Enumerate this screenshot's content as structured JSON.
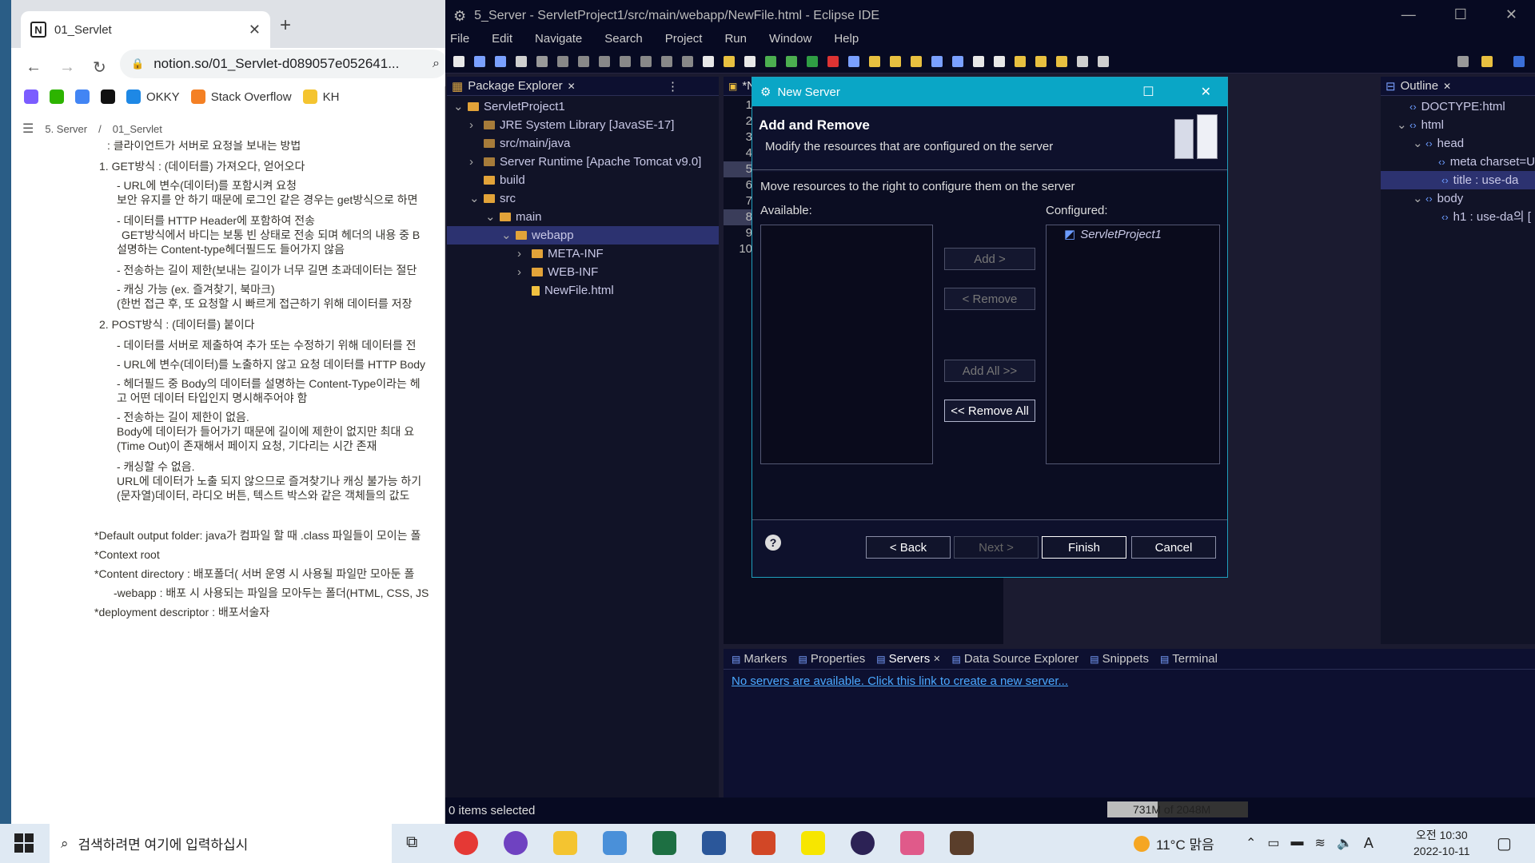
{
  "browser": {
    "tab_title": "01_Servlet",
    "url": "notion.so/01_Servlet-d089057e052641...",
    "bookmarks": [
      {
        "label": "",
        "color": "#7b5cff"
      },
      {
        "label": "",
        "color": "#2db400"
      },
      {
        "label": "",
        "color": "#4285f4"
      },
      {
        "label": "",
        "color": "#111111"
      },
      {
        "label": "OKKY",
        "color": "#1e88e5"
      },
      {
        "label": "Stack Overflow",
        "color": "#f48024"
      },
      {
        "label": "KH",
        "color": "#f4c430"
      }
    ],
    "breadcrumb": [
      "5. Server",
      "/",
      "01_Servlet"
    ]
  },
  "notion_lines": [
    ": 클라이언트가 서버로 요청을 보내는 방법",
    "1.  GET방식 : (데이터를) 가져오다, 얻어오다",
    "- URL에 변수(데이터)를 포함시켜 요청",
    "보안 유지를 안 하기 때문에 로그인 같은 경우는 get방식으로 하면",
    "- 데이터를 HTTP Header에 포함하여 전송",
    "GET방식에서 바디는 보통 빈 상태로 전송 되며 헤더의 내용 중 B",
    "설명하는 Content-type헤더필드도 들어가지 않음",
    "- 전송하는 길이 제한(보내는 길이가 너무 길면 초과데이터는 절단",
    "- 캐싱 가능 (ex. 즐겨찾기, 북마크)",
    "(한번 접근 후, 또 요청할 시 빠르게 접근하기 위해 데이터를 저장",
    "2.  POST방식 : (데이터를) 붙이다",
    "- 데이터를 서버로 제출하여 추가 또는 수정하기 위해 데이터를 전",
    "- URL에 변수(데이터)를 노출하지 않고 요청 데이터를 HTTP Body",
    "- 헤더필드 중 Body의 데이터를 설명하는 Content-Type이라는 헤",
    "고 어떤 데이터 타입인지 명시해주어야 함",
    "- 전송하는 길이 제한이 없음.",
    "Body에 데이터가 들어가기 때문에 길이에 제한이 없지만 최대 요",
    "(Time Out)이 존재해서 페이지 요청, 기다리는 시간 존재",
    "- 캐싱할 수 없음.",
    "URL에 데이터가 노출 되지 않으므로 즐겨찾기나 캐싱 불가능 하기",
    "(문자열)데이터, 라디오 버튼, 텍스트 박스와 같은 객체들의 값도",
    "*Default output folder: java가 컴파일 할 때 .class 파일들이 모이는 폴",
    "*Context root",
    "*Content directory : 배포폴더( 서버 운영 시 사용될 파일만 모아둔 폴",
    "-webapp : 배포 시 사용되는 파일을 모아두는 폴더(HTML, CSS, JS",
    "*deployment descriptor : 배포서술자"
  ],
  "eclipse": {
    "title": "5_Server - ServletProject1/src/main/webapp/NewFile.html - Eclipse IDE",
    "menu": [
      "File",
      "Edit",
      "Navigate",
      "Search",
      "Project",
      "Run",
      "Window",
      "Help"
    ],
    "package_explorer": {
      "title": "Package Explorer",
      "items": [
        {
          "label": "ServletProject1",
          "depth": 0,
          "arrow": "v",
          "icon": "project"
        },
        {
          "label": "JRE System Library [JavaSE-17]",
          "depth": 1,
          "arrow": ">",
          "icon": "lib"
        },
        {
          "label": "src/main/java",
          "depth": 1,
          "arrow": "",
          "icon": "pkg"
        },
        {
          "label": "Server Runtime [Apache Tomcat v9.0]",
          "depth": 1,
          "arrow": ">",
          "icon": "lib"
        },
        {
          "label": "build",
          "depth": 1,
          "arrow": "",
          "icon": "folder"
        },
        {
          "label": "src",
          "depth": 1,
          "arrow": "v",
          "icon": "folder"
        },
        {
          "label": "main",
          "depth": 2,
          "arrow": "v",
          "icon": "folder"
        },
        {
          "label": "webapp",
          "depth": 3,
          "arrow": "v",
          "icon": "folder",
          "selected": true
        },
        {
          "label": "META-INF",
          "depth": 4,
          "arrow": ">",
          "icon": "folder"
        },
        {
          "label": "WEB-INF",
          "depth": 4,
          "arrow": ">",
          "icon": "folder"
        },
        {
          "label": "NewFile.html",
          "depth": 4,
          "arrow": "",
          "icon": "html"
        }
      ]
    },
    "editor_tab": "*N",
    "line_numbers": [
      "1",
      "2",
      "3",
      "4",
      "5",
      "6",
      "7",
      "8",
      "9",
      "10"
    ],
    "outline": {
      "title": "Outline",
      "items": [
        {
          "label": "DOCTYPE:html",
          "depth": 0,
          "arrow": ""
        },
        {
          "label": "html",
          "depth": 0,
          "arrow": "v"
        },
        {
          "label": "head",
          "depth": 1,
          "arrow": "v"
        },
        {
          "label": "meta charset=U",
          "depth": 2,
          "arrow": ""
        },
        {
          "label": "title : use-da",
          "depth": 2,
          "arrow": "",
          "selected": true
        },
        {
          "label": "body",
          "depth": 1,
          "arrow": "v"
        },
        {
          "label": "h1 : use-da의 [",
          "depth": 2,
          "arrow": ""
        }
      ]
    },
    "bottom_tabs": [
      "Markers",
      "Properties",
      "Servers",
      "Data Source Explorer",
      "Snippets",
      "Terminal"
    ],
    "servers_link": "No servers are available. Click this link to create a new server...",
    "status_text": "0 items selected",
    "heap": "731M of 2048M",
    "heap_used_fraction": 0.357
  },
  "dialog": {
    "title": "New Server",
    "heading": "Add and Remove",
    "subheading": "Modify the resources that are configured on the server",
    "instruction": "Move resources to the right to configure them on the server",
    "available_label": "Available:",
    "configured_label": "Configured:",
    "configured_items": [
      "ServletProject1"
    ],
    "btn_add": "Add >",
    "btn_remove": "< Remove",
    "btn_add_all": "Add All >>",
    "btn_remove_all": "<< Remove All",
    "btn_back": "< Back",
    "btn_next": "Next >",
    "btn_finish": "Finish",
    "btn_cancel": "Cancel"
  },
  "taskbar": {
    "search_placeholder": "검색하려면 여기에 입력하십시",
    "weather": "11°C  맑음",
    "time": "오전 10:30",
    "date": "2022-10-11",
    "ime": "A"
  }
}
